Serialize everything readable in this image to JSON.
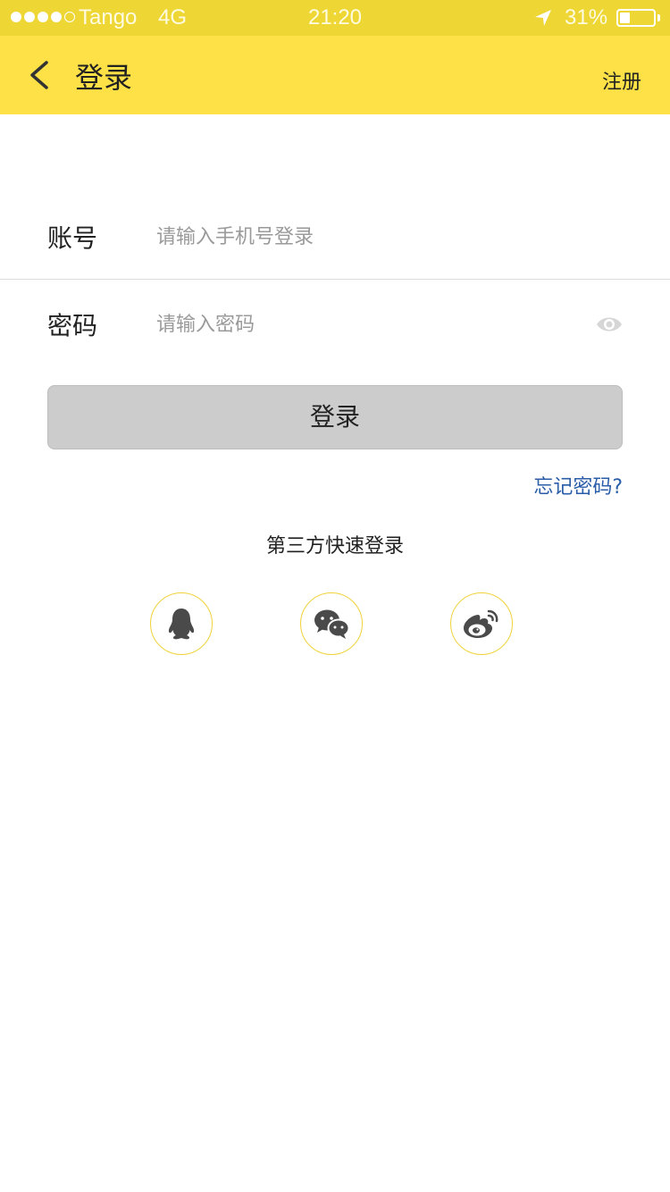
{
  "status_bar": {
    "carrier": "Tango",
    "network": "4G",
    "time": "21:20",
    "battery": "31%",
    "battery_level": 0.31,
    "signal_bars_filled": 4,
    "signal_bars_total": 5
  },
  "nav": {
    "back_icon": "chevron-left-icon",
    "title": "登录",
    "register": "注册"
  },
  "form": {
    "account_label": "账号",
    "account_placeholder": "请输入手机号登录",
    "account_value": "",
    "password_label": "密码",
    "password_placeholder": "请输入密码",
    "password_value": "",
    "eye_icon": "eye-icon"
  },
  "login_button": "登录",
  "forgot_password": "忘记密码?",
  "third_party": {
    "title": "第三方快速登录",
    "providers": [
      {
        "icon": "qq-icon"
      },
      {
        "icon": "wechat-icon"
      },
      {
        "icon": "weibo-icon"
      }
    ]
  },
  "colors": {
    "status_bar_bg": "#eed635",
    "nav_bg": "#fde146",
    "button_bg": "#cccccc",
    "link": "#2a5da8",
    "social_ring": "#f0d23a",
    "icon_gray": "#4a4a4a"
  }
}
